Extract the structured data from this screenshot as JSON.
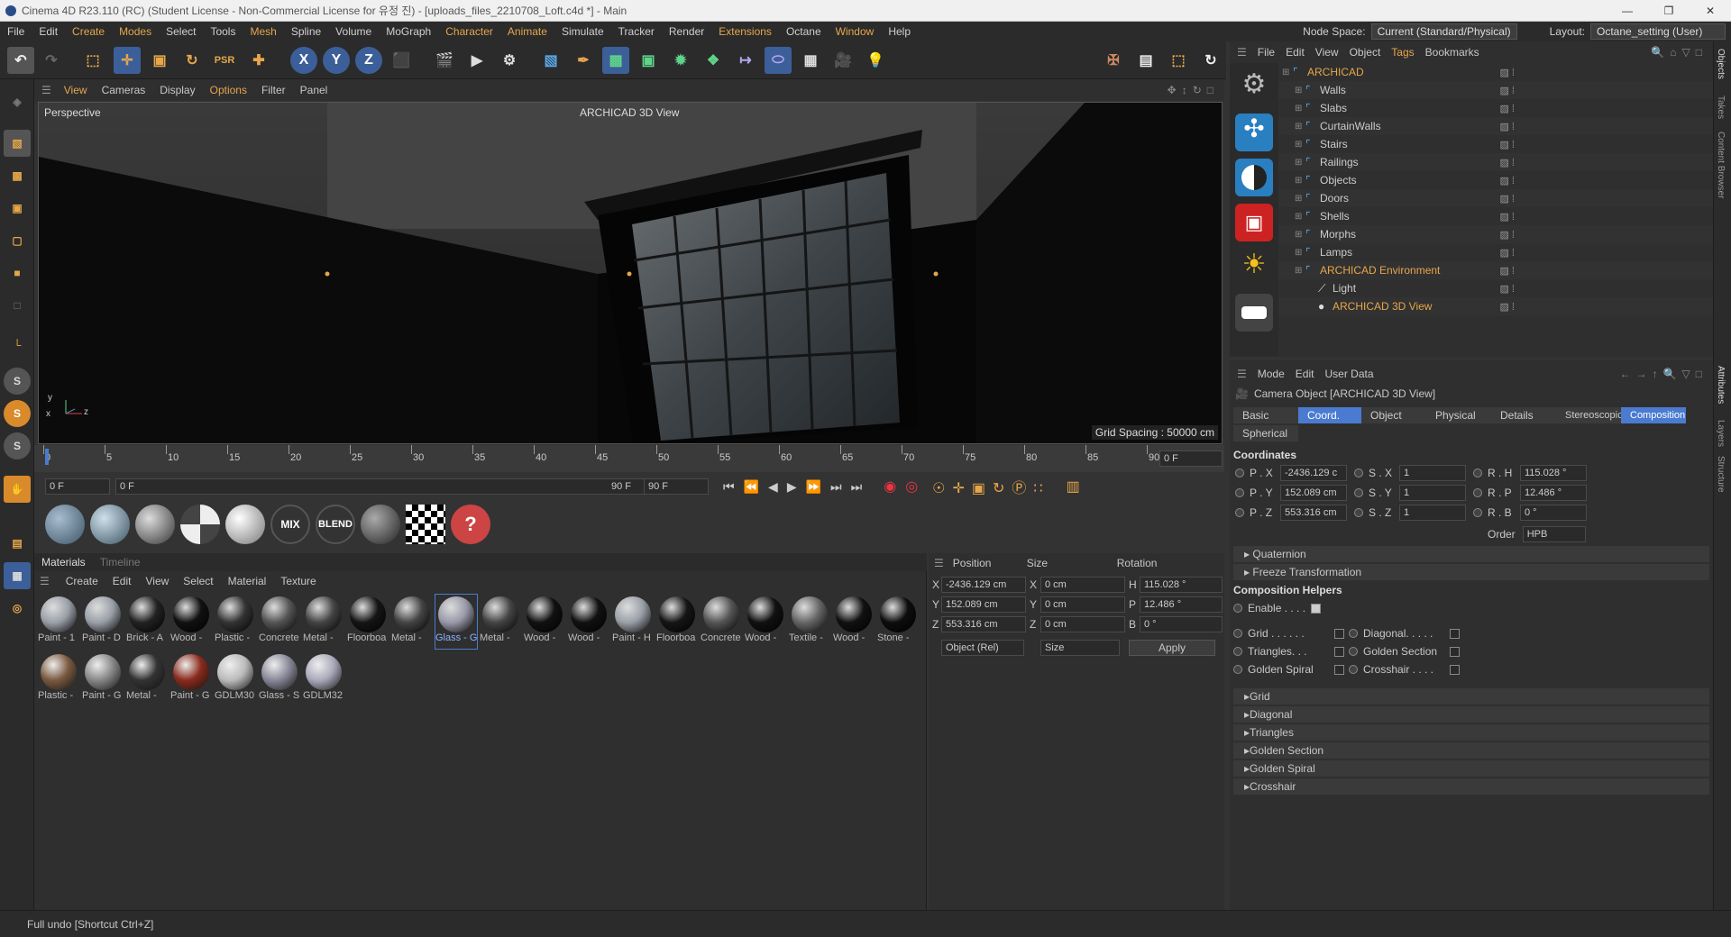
{
  "window": {
    "title": "Cinema 4D R23.110 (RC) (Student License - Non-Commercial License for 유정 진) - [uploads_files_2210708_Loft.c4d *] - Main"
  },
  "menubar": {
    "items": [
      "File",
      "Edit",
      "Create",
      "Modes",
      "Select",
      "Tools",
      "Mesh",
      "Spline",
      "Volume",
      "MoGraph",
      "Character",
      "Animate",
      "Simulate",
      "Tracker",
      "Render",
      "Extensions",
      "Octane",
      "Window",
      "Help"
    ],
    "node_space_label": "Node Space:",
    "node_space_value": "Current (Standard/Physical)",
    "layout_label": "Layout:",
    "layout_value": "Octane_setting (User)"
  },
  "toolbar": {
    "axis_x": "X",
    "axis_y": "Y",
    "axis_z": "Z"
  },
  "viewport": {
    "menu": [
      "View",
      "Cameras",
      "Display",
      "Options",
      "Filter",
      "Panel"
    ],
    "name": "Perspective",
    "camera_label": "ARCHICAD 3D View",
    "grid_spacing": "Grid Spacing : 50000 cm",
    "axis_x": "x",
    "axis_y": "y",
    "axis_z": "z"
  },
  "timeline": {
    "ticks": [
      "0",
      "5",
      "10",
      "15",
      "20",
      "25",
      "30",
      "35",
      "40",
      "45",
      "50",
      "55",
      "60",
      "65",
      "70",
      "75",
      "80",
      "85",
      "90"
    ],
    "current_frame": "0 F"
  },
  "transport": {
    "start": "0 F",
    "current": "0 F",
    "end_label": "90 F",
    "end": "90 F"
  },
  "material_presets": {
    "mix": "MIX",
    "blend": "BLEND"
  },
  "materials": {
    "tabs": [
      "Materials",
      "Timeline"
    ],
    "menu": [
      "Create",
      "Edit",
      "View",
      "Select",
      "Material",
      "Texture"
    ],
    "row1": [
      "Paint - 1",
      "Paint - D",
      "Brick - A",
      "Wood -",
      "Plastic -",
      "Concrete",
      "Metal -",
      "Floorboa",
      "Metal -",
      "Glass - G",
      "Metal -",
      "Wood -",
      "Wood -",
      "Paint - H",
      "Floorboa",
      "Concrete",
      "Wood -",
      "Textile -",
      "Wood -",
      "Stone -"
    ],
    "row2": [
      "Plastic -",
      "Paint - G",
      "Metal -",
      "Paint - G",
      "GDLM30",
      "Glass - S",
      "GDLM32"
    ]
  },
  "coordinates": {
    "headers": [
      "Position",
      "Size",
      "Rotation"
    ],
    "rows": [
      {
        "axis": "X",
        "pos": "-2436.129 cm",
        "saxis": "X",
        "size": "0 cm",
        "raxis": "H",
        "rot": "115.028 °"
      },
      {
        "axis": "Y",
        "pos": "152.089 cm",
        "saxis": "Y",
        "size": "0 cm",
        "raxis": "P",
        "rot": "12.486 °"
      },
      {
        "axis": "Z",
        "pos": "553.316 cm",
        "saxis": "Z",
        "size": "0 cm",
        "raxis": "B",
        "rot": "0 °"
      }
    ],
    "mode": "Object (Rel)",
    "size_mode": "Size",
    "apply": "Apply"
  },
  "object_manager": {
    "menu": [
      "File",
      "Edit",
      "View",
      "Object",
      "Tags",
      "Bookmarks"
    ],
    "objects": [
      "ARCHICAD",
      "Walls",
      "Slabs",
      "CurtainWalls",
      "Stairs",
      "Railings",
      "Objects",
      "Doors",
      "Shells",
      "Morphs",
      "Lamps",
      "ARCHICAD Environment",
      "Light",
      "ARCHICAD 3D View"
    ]
  },
  "attributes": {
    "menu": [
      "Mode",
      "Edit",
      "User Data"
    ],
    "object_title": "Camera Object [ARCHICAD 3D View]",
    "tabs": [
      "Basic",
      "Coord.",
      "Object",
      "Physical",
      "Details",
      "Stereoscopic",
      "Composition",
      "Spherical"
    ],
    "section": "Coordinates",
    "coords": [
      {
        "p": "P . X",
        "pv": "-2436.129 c",
        "s": "S . X",
        "sv": "1",
        "r": "R . H",
        "rv": "115.028 °"
      },
      {
        "p": "P . Y",
        "pv": "152.089 cm",
        "s": "S . Y",
        "sv": "1",
        "r": "R . P",
        "rv": "12.486 °"
      },
      {
        "p": "P . Z",
        "pv": "553.316 cm",
        "s": "S . Z",
        "sv": "1",
        "r": "R . B",
        "rv": "0 °"
      }
    ],
    "order_label": "Order",
    "order_value": "HPB",
    "quaternion": "Quaternion",
    "freeze": "Freeze Transformation",
    "helpers_title": "Composition Helpers",
    "enable": "Enable . . . .",
    "grid": "Grid . . . . . .",
    "diagonal": "Diagonal. . . . .",
    "triangles": "Triangles. . .",
    "golden_section": "Golden Section",
    "golden_spiral": "Golden Spiral",
    "crosshair": "Crosshair . . . .",
    "collapsed": [
      "Grid",
      "Diagonal",
      "Triangles",
      "Golden Section",
      "Golden Spiral",
      "Crosshair"
    ]
  },
  "right_tabs": [
    "Objects",
    "Takes",
    "Content Browser",
    "Attributes",
    "Layers",
    "Structure"
  ],
  "status": {
    "text": "Full undo [Shortcut Ctrl+Z]"
  },
  "colors": {
    "accent": "#e6a64b",
    "selected_tab": "#4a7bd0",
    "bg": "#333333"
  }
}
